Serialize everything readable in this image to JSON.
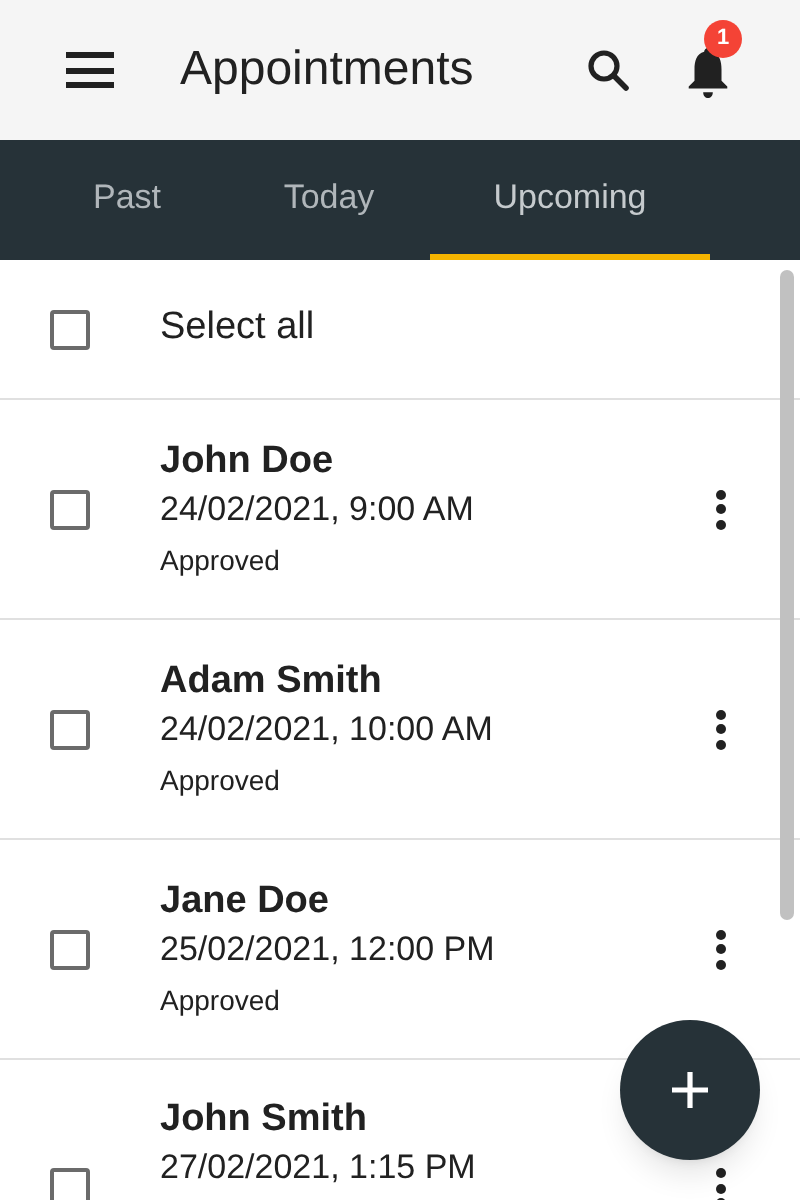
{
  "app_bar": {
    "title": "Appointments",
    "notification_count": "1"
  },
  "tabs": [
    {
      "label": "Past",
      "selected": false
    },
    {
      "label": "Today",
      "selected": false
    },
    {
      "label": "Upcoming",
      "selected": true
    }
  ],
  "select_all": {
    "label": "Select all",
    "checked": false
  },
  "appointments": [
    {
      "name": "John Doe",
      "datetime": "24/02/2021, 9:00 AM",
      "status": "Approved",
      "checked": false
    },
    {
      "name": "Adam Smith",
      "datetime": "24/02/2021, 10:00 AM",
      "status": "Approved",
      "checked": false
    },
    {
      "name": "Jane Doe",
      "datetime": "25/02/2021, 12:00 PM",
      "status": "Approved",
      "checked": false
    },
    {
      "name": "John Smith",
      "datetime": "27/02/2021, 1:15 PM",
      "checked": false
    }
  ]
}
